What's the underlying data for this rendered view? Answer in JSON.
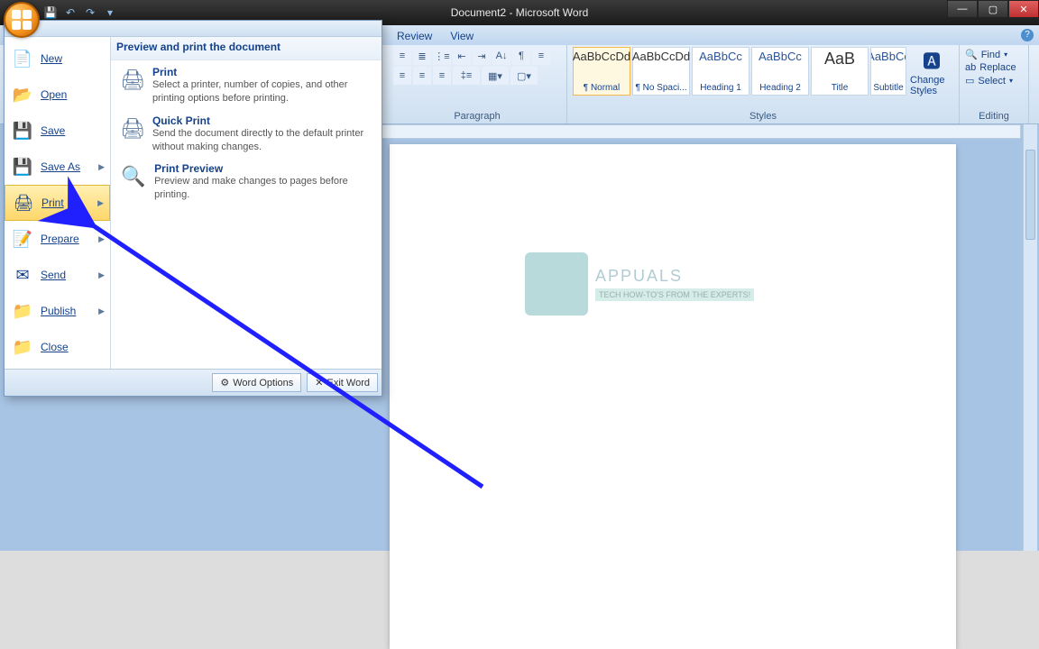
{
  "titlebar": {
    "title": "Document2 - Microsoft Word"
  },
  "ribbon_tabs": {
    "review": "Review",
    "view": "View"
  },
  "paragraph_group": "Paragraph",
  "styles_group": "Styles",
  "editing_group": "Editing",
  "styles": [
    {
      "preview": "AaBbCcDd",
      "name": "¶ Normal"
    },
    {
      "preview": "AaBbCcDd",
      "name": "¶ No Spaci..."
    },
    {
      "preview": "AaBbCc",
      "name": "Heading 1"
    },
    {
      "preview": "AaBbCc",
      "name": "Heading 2"
    },
    {
      "preview": "AaB",
      "name": "Title"
    },
    {
      "preview": "AaBbCc",
      "name": "Subtitle"
    }
  ],
  "change_styles": "Change Styles",
  "editing": {
    "find": "Find",
    "replace": "Replace",
    "select": "Select"
  },
  "office_menu": {
    "items": [
      {
        "label": "New"
      },
      {
        "label": "Open"
      },
      {
        "label": "Save"
      },
      {
        "label": "Save As"
      },
      {
        "label": "Print"
      },
      {
        "label": "Prepare"
      },
      {
        "label": "Send"
      },
      {
        "label": "Publish"
      },
      {
        "label": "Close"
      }
    ],
    "panel_header": "Preview and print the document",
    "sub": [
      {
        "title": "Print",
        "desc": "Select a printer, number of copies, and other printing options before printing."
      },
      {
        "title": "Quick Print",
        "desc": "Send the document directly to the default printer without making changes."
      },
      {
        "title": "Print Preview",
        "desc": "Preview and make changes to pages before printing."
      }
    ],
    "word_options": "Word Options",
    "exit_word": "Exit Word"
  },
  "watermark": {
    "brand": "APPUALS",
    "sub": "TECH HOW-TO'S FROM THE EXPERTS!"
  }
}
